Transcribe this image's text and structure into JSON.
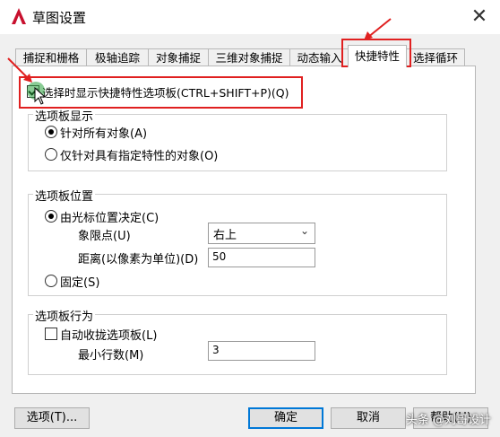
{
  "window": {
    "title": "草图设置",
    "close_icon": "close-icon"
  },
  "tabs": [
    {
      "label": "捕捉和栅格"
    },
    {
      "label": "极轴追踪"
    },
    {
      "label": "对象捕捉"
    },
    {
      "label": "三维对象捕捉"
    },
    {
      "label": "动态输入"
    },
    {
      "label": "快捷特性",
      "active": true
    },
    {
      "label": "选择循环"
    }
  ],
  "main_checkbox": {
    "label": "选择时显示快捷特性选项板(CTRL+SHIFT+P)(Q)",
    "checked": true
  },
  "display_group": {
    "title": "选项板显示",
    "options": [
      {
        "label": "针对所有对象(A)",
        "checked": true
      },
      {
        "label": "仅针对具有指定特性的对象(O)",
        "checked": false
      }
    ]
  },
  "location_group": {
    "title": "选项板位置",
    "cursor_option": {
      "label": "由光标位置决定(C)",
      "checked": true
    },
    "quadrant": {
      "label": "象限点(U)",
      "value": "右上"
    },
    "distance": {
      "label": "距离(以像素为单位)(D)",
      "value": "50"
    },
    "static_option": {
      "label": "固定(S)",
      "checked": false
    }
  },
  "behavior_group": {
    "title": "选项板行为",
    "auto_collapse": {
      "label": "自动收拢选项板(L)",
      "checked": false
    },
    "min_rows": {
      "label": "最小行数(M)",
      "value": "3"
    }
  },
  "footer": {
    "options_label": "选项(T)...",
    "ok_label": "确定",
    "cancel_label": "取消",
    "help_label": "帮助(H)"
  },
  "watermark": "头条 @刘哥设计",
  "colors": {
    "highlight": "#e02020",
    "accent": "#0078d7",
    "app_icon": "#c8102e"
  }
}
